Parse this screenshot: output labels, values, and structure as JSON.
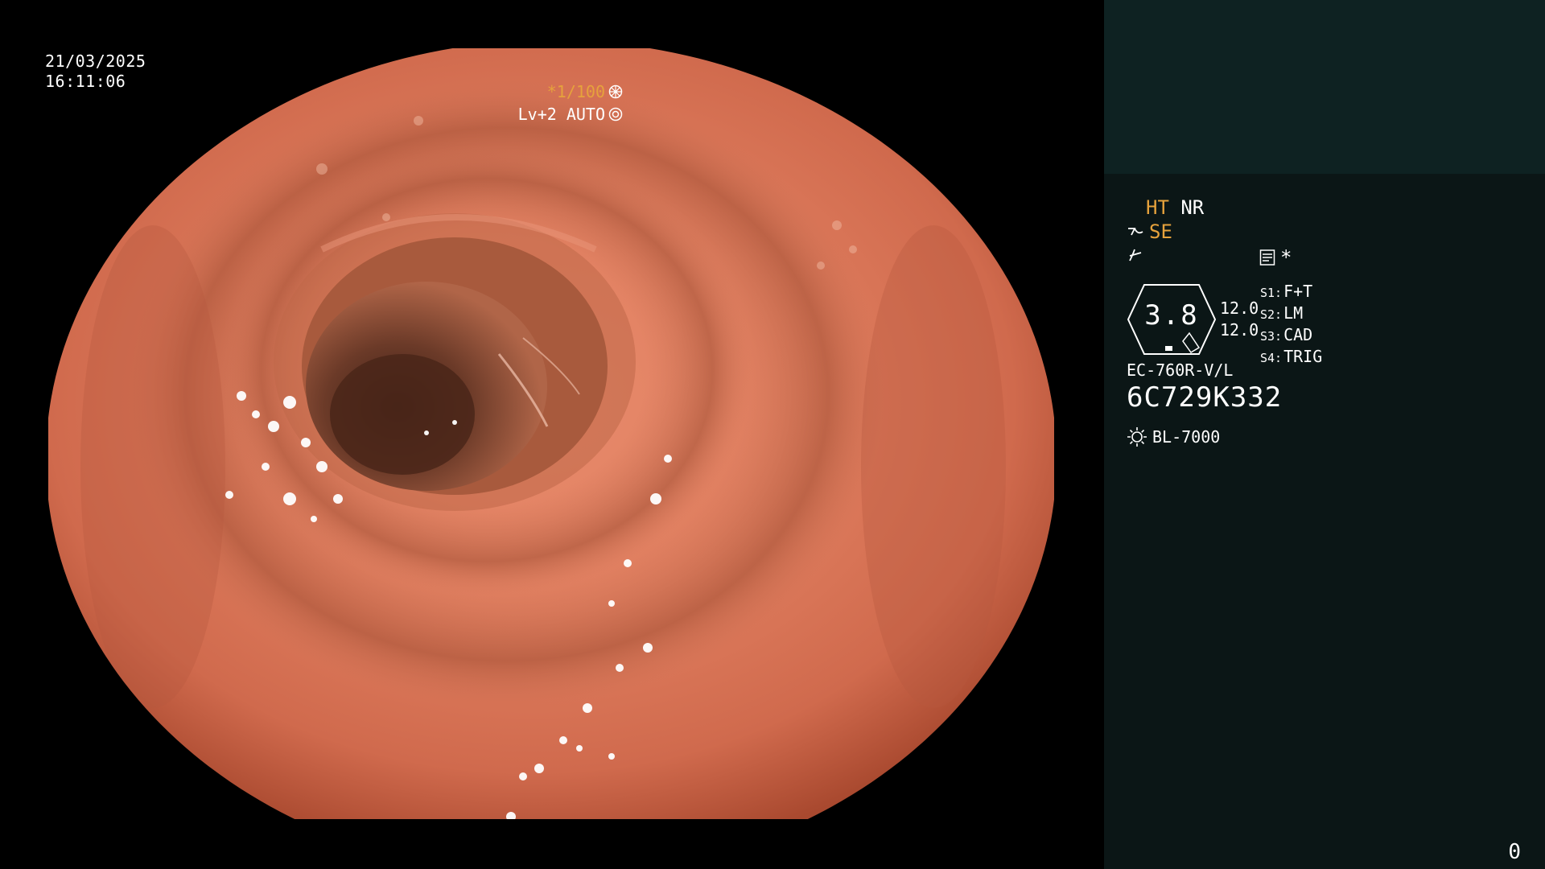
{
  "overlay": {
    "date": "21/03/2025",
    "time": "16:11:06",
    "shutter": "*1/100",
    "level": "Lv+2 AUTO"
  },
  "panel": {
    "ht": "HT",
    "nr": "NR",
    "se": "SE",
    "asterisk": "*",
    "indicator_value": "3.8",
    "gain_1": "12.0",
    "gain_2": "12.0",
    "switches": [
      {
        "key": "S1:",
        "value": "F+T"
      },
      {
        "key": "S2:",
        "value": "LM"
      },
      {
        "key": "S3:",
        "value": "CAD"
      },
      {
        "key": "S4:",
        "value": "TRIG"
      }
    ],
    "scope_model": "EC-760R-V/L",
    "serial_number": "6C729K332",
    "light_source": "BL-7000",
    "page_number": "0"
  },
  "colors": {
    "shutter_accent": "#e6a23c",
    "panel_bg": "#0b1616",
    "panel_top_bg": "#0e2222",
    "mucosa": "#d9785c",
    "lumen": "#5a3426"
  },
  "icons": [
    "aperture-icon",
    "iris-icon",
    "structure-enhance-icon",
    "color-enhance-icon",
    "memory-icon",
    "light-source-icon"
  ]
}
